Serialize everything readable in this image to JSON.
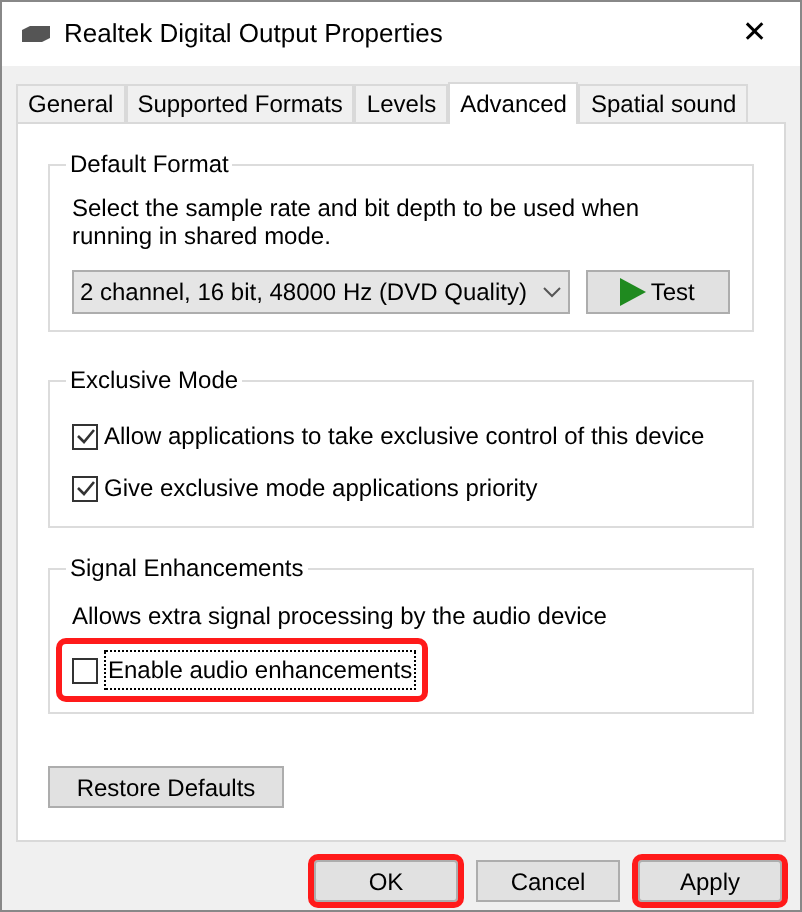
{
  "window": {
    "title": "Realtek Digital Output Properties",
    "close": "✕"
  },
  "tabs": [
    {
      "label": "General",
      "selected": false
    },
    {
      "label": "Supported Formats",
      "selected": false
    },
    {
      "label": "Levels",
      "selected": false
    },
    {
      "label": "Advanced",
      "selected": true
    },
    {
      "label": "Spatial sound",
      "selected": false
    }
  ],
  "default_format": {
    "title": "Default Format",
    "description": "Select the sample rate and bit depth to be used when running in shared mode.",
    "format_value": "2 channel, 16 bit, 48000 Hz (DVD Quality)",
    "test_button": "Test"
  },
  "exclusive_mode": {
    "title": "Exclusive Mode",
    "options": [
      {
        "label": "Allow applications to take exclusive control of this device",
        "checked": true,
        "highlighted": false
      },
      {
        "label": "Give exclusive mode applications priority",
        "checked": true,
        "highlighted": false
      }
    ]
  },
  "signal_enhancements": {
    "title": "Signal Enhancements",
    "description": "Allows extra signal processing by the audio device",
    "options": [
      {
        "label": "Enable audio enhancements",
        "checked": false,
        "highlighted": true
      }
    ]
  },
  "restore_button": "Restore Defaults",
  "buttons": [
    {
      "label": "OK",
      "highlighted": true
    },
    {
      "label": "Cancel",
      "highlighted": false
    },
    {
      "label": "Apply",
      "highlighted": true
    }
  ]
}
